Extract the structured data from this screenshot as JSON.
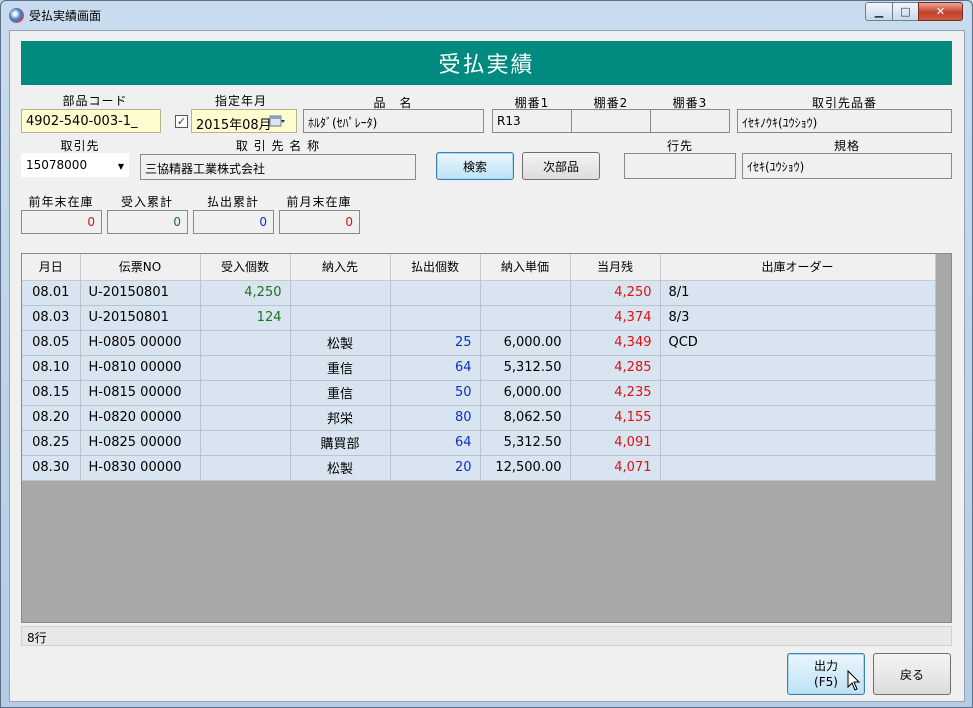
{
  "window": {
    "title": "受払実績画面"
  },
  "header": {
    "title": "受払実績"
  },
  "labels": {
    "part_code": "部品コード",
    "year_month": "指定年月",
    "part_name": "品　名",
    "shelf1": "棚番1",
    "shelf2": "棚番2",
    "shelf3": "棚番3",
    "supplier_part_no": "取引先品番",
    "supplier": "取引先",
    "supplier_name": "取 引 先 名 称",
    "destination": "行先",
    "spec": "規格",
    "prev_year_end_stock": "前年末在庫",
    "received_total": "受入累計",
    "issued_total": "払出累計",
    "prev_month_end_stock": "前月末在庫"
  },
  "fields": {
    "part_code": "4902-540-003-1_",
    "year_month": "2015年08月",
    "year_month_checked": true,
    "part_name": "ﾎﾙﾀﾞ(ｾﾊﾟﾚｰﾀ)",
    "shelf1": "R13",
    "shelf2": "",
    "shelf3": "",
    "supplier_part_no": "ｲｾｷﾉｳｷ(ﾕｳｼｮｳ)",
    "supplier": "15078000",
    "supplier_name": "三協精器工業株式会社",
    "destination": "",
    "spec": "ｲｾｷ(ﾕｳｼｮｳ)",
    "prev_year_end_stock": "0",
    "received_total": "0",
    "issued_total": "0",
    "prev_month_end_stock": "0"
  },
  "buttons": {
    "search": "検索",
    "next_part": "次部品",
    "output_line1": "出力",
    "output_line2": "(F5)",
    "back": "戻る"
  },
  "table": {
    "headers": [
      "月日",
      "伝票NO",
      "受入個数",
      "納入先",
      "払出個数",
      "納入単価",
      "当月残",
      "出庫オーダー"
    ],
    "rows": [
      [
        "08.01",
        "U-20150801",
        "4,250",
        "",
        "",
        "",
        "4,250",
        "8/1"
      ],
      [
        "08.03",
        "U-20150801",
        "124",
        "",
        "",
        "",
        "4,374",
        "8/3"
      ],
      [
        "08.05",
        "H-0805 00000",
        "",
        "松製",
        "25",
        "6,000.00",
        "4,349",
        "QCD"
      ],
      [
        "08.10",
        "H-0810 00000",
        "",
        "重信",
        "64",
        "5,312.50",
        "4,285",
        ""
      ],
      [
        "08.15",
        "H-0815 00000",
        "",
        "重信",
        "50",
        "6,000.00",
        "4,235",
        ""
      ],
      [
        "08.20",
        "H-0820 00000",
        "",
        "邦栄",
        "80",
        "8,062.50",
        "4,155",
        ""
      ],
      [
        "08.25",
        "H-0825 00000",
        "",
        "購買部",
        "64",
        "5,312.50",
        "4,091",
        ""
      ],
      [
        "08.30",
        "H-0830 00000",
        "",
        "松製",
        "20",
        "12,500.00",
        "4,071",
        ""
      ]
    ]
  },
  "status": {
    "row_count": "8行"
  },
  "colors": {
    "header_band": "#008a80",
    "received": "#207020",
    "issued": "#1030c0",
    "balance": "#e01010"
  }
}
